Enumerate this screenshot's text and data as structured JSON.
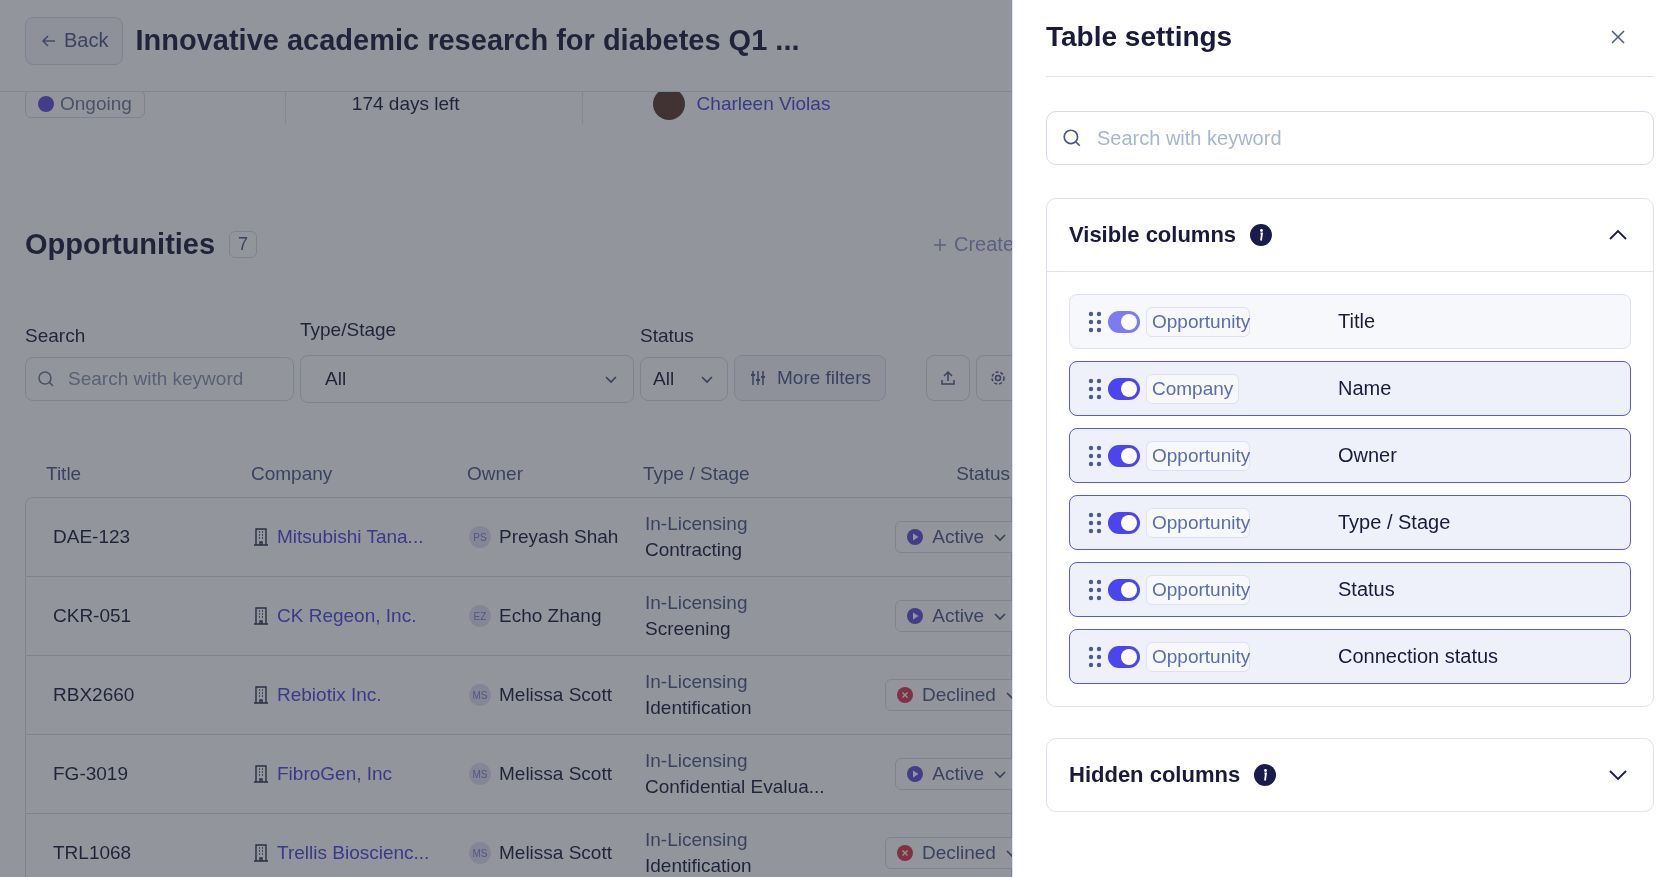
{
  "page": {
    "back_label": "Back",
    "title": "Innovative academic research for diabetes Q1 ...",
    "summary": {
      "status": "Ongoing",
      "days_left": "174 days left",
      "owner": "Charleen Violas"
    },
    "section": {
      "title": "Opportunities",
      "count": "7",
      "create_label": "Create"
    },
    "filters": {
      "search": {
        "label": "Search",
        "placeholder": "Search with keyword"
      },
      "type_stage": {
        "label": "Type/Stage",
        "value": "All"
      },
      "status": {
        "label": "Status",
        "value": "All"
      },
      "more_filters": "More filters"
    },
    "table": {
      "columns": [
        "Title",
        "Company",
        "Owner",
        "Type / Stage",
        "Status"
      ],
      "rows": [
        {
          "title": "DAE-123",
          "company": "Mitsubishi Tana...",
          "owner_initials": "PS",
          "owner": "Preyash Shah",
          "type": "In-Licensing",
          "stage": "Contracting",
          "status": {
            "label": "Active",
            "kind": "active"
          }
        },
        {
          "title": "CKR-051",
          "company": "CK Regeon, Inc.",
          "owner_initials": "EZ",
          "owner": "Echo Zhang",
          "type": "In-Licensing",
          "stage": "Screening",
          "status": {
            "label": "Active",
            "kind": "active"
          }
        },
        {
          "title": "RBX2660",
          "company": "Rebiotix Inc.",
          "owner_initials": "MS",
          "owner": "Melissa Scott",
          "type": "In-Licensing",
          "stage": "Identification",
          "status": {
            "label": "Declined",
            "kind": "declined"
          }
        },
        {
          "title": "FG-3019",
          "company": "FibroGen, Inc",
          "owner_initials": "MS",
          "owner": "Melissa Scott",
          "type": "In-Licensing",
          "stage": "Confidential Evalua...",
          "status": {
            "label": "Active",
            "kind": "active"
          }
        },
        {
          "title": "TRL1068",
          "company": "Trellis Bioscienc...",
          "owner_initials": "MS",
          "owner": "Melissa Scott",
          "type": "In-Licensing",
          "stage": "Identification",
          "status": {
            "label": "Declined",
            "kind": "declined"
          }
        }
      ]
    }
  },
  "panel": {
    "title": "Table settings",
    "search_placeholder": "Search with keyword",
    "visible_columns": {
      "title": "Visible columns",
      "expanded": true,
      "items": [
        {
          "entity": "Opportunity",
          "name": "Title",
          "on": true,
          "locked": true
        },
        {
          "entity": "Company",
          "name": "Name",
          "on": true,
          "locked": false
        },
        {
          "entity": "Opportunity",
          "name": "Owner",
          "on": true,
          "locked": false
        },
        {
          "entity": "Opportunity",
          "name": "Type / Stage",
          "on": true,
          "locked": false
        },
        {
          "entity": "Opportunity",
          "name": "Status",
          "on": true,
          "locked": false
        },
        {
          "entity": "Opportunity",
          "name": "Connection status",
          "on": true,
          "locked": false
        }
      ]
    },
    "hidden_columns": {
      "title": "Hidden columns",
      "expanded": false
    }
  }
}
